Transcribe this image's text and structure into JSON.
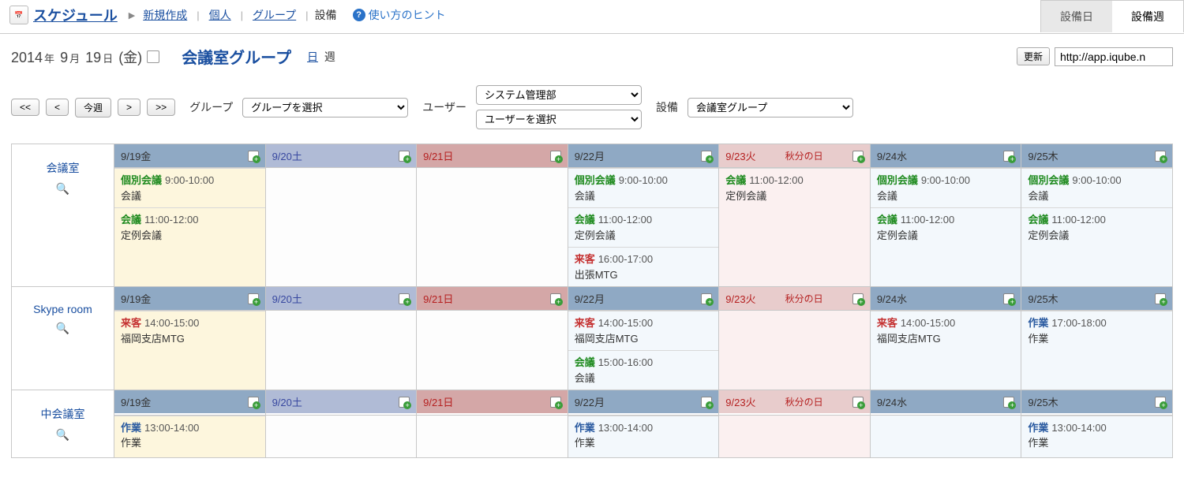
{
  "nav": {
    "main": "スケジュール",
    "links": [
      "新規作成",
      "個人",
      "グループ"
    ],
    "static": "設備",
    "hint": "使い方のヒント"
  },
  "tabs": {
    "facility_day": "設備日",
    "facility_week": "設備週"
  },
  "header": {
    "year": "2014",
    "year_u": "年",
    "month": "9",
    "month_u": "月",
    "day": "19",
    "day_u": "日",
    "dow": "(金)",
    "group_title": "会議室グループ",
    "day_link": "日",
    "week_static": "週",
    "update_btn": "更新",
    "url": "http://app.iqube.n"
  },
  "filters": {
    "nav": {
      "first": "<<",
      "prev": "<",
      "today": "今週",
      "next": ">",
      "last": ">>"
    },
    "group_label": "グループ",
    "group_select": "グループを選択",
    "user_label": "ユーザー",
    "dept_select": "システム管理部",
    "user_select": "ユーザーを選択",
    "facility_label": "設備",
    "facility_select": "会議室グループ"
  },
  "days": [
    {
      "label": "9/19金",
      "cls": "fri"
    },
    {
      "label": "9/20土",
      "cls": "sat"
    },
    {
      "label": "9/21日",
      "cls": "sun"
    },
    {
      "label": "9/22月",
      "cls": "wday"
    },
    {
      "label": "9/23火",
      "cls": "hol",
      "holiday": "秋分の日"
    },
    {
      "label": "9/24水",
      "cls": "wday"
    },
    {
      "label": "9/25木",
      "cls": "wday"
    }
  ],
  "resources": [
    {
      "name": "会議室",
      "cells": [
        [
          {
            "tag": "個別会議",
            "tagcls": "green",
            "time": "9:00-10:00",
            "title": "会議"
          },
          {
            "tag": "会議",
            "tagcls": "green",
            "time": "11:00-12:00",
            "title": "定例会議"
          }
        ],
        [],
        [],
        [
          {
            "tag": "個別会議",
            "tagcls": "green",
            "time": "9:00-10:00",
            "title": "会議"
          },
          {
            "tag": "会議",
            "tagcls": "green",
            "time": "11:00-12:00",
            "title": "定例会議"
          },
          {
            "tag": "来客",
            "tagcls": "red",
            "time": "16:00-17:00",
            "title": "出張MTG"
          }
        ],
        [
          {
            "tag": "会議",
            "tagcls": "green",
            "time": "11:00-12:00",
            "title": "定例会議"
          }
        ],
        [
          {
            "tag": "個別会議",
            "tagcls": "green",
            "time": "9:00-10:00",
            "title": "会議"
          },
          {
            "tag": "会議",
            "tagcls": "green",
            "time": "11:00-12:00",
            "title": "定例会議"
          }
        ],
        [
          {
            "tag": "個別会議",
            "tagcls": "green",
            "time": "9:00-10:00",
            "title": "会議"
          },
          {
            "tag": "会議",
            "tagcls": "green",
            "time": "11:00-12:00",
            "title": "定例会議"
          }
        ]
      ]
    },
    {
      "name": "Skype room",
      "cells": [
        [
          {
            "tag": "来客",
            "tagcls": "red",
            "time": "14:00-15:00",
            "title": "福岡支店MTG"
          }
        ],
        [],
        [],
        [
          {
            "tag": "来客",
            "tagcls": "red",
            "time": "14:00-15:00",
            "title": "福岡支店MTG"
          },
          {
            "tag": "会議",
            "tagcls": "green",
            "time": "15:00-16:00",
            "title": "会議"
          }
        ],
        [],
        [
          {
            "tag": "来客",
            "tagcls": "red",
            "time": "14:00-15:00",
            "title": "福岡支店MTG"
          }
        ],
        [
          {
            "tag": "作業",
            "tagcls": "blue",
            "time": "17:00-18:00",
            "title": "作業"
          }
        ]
      ]
    },
    {
      "name": "中会議室",
      "cells": [
        [
          {
            "tag": "作業",
            "tagcls": "blue",
            "time": "13:00-14:00",
            "title": "作業"
          }
        ],
        [],
        [],
        [
          {
            "tag": "作業",
            "tagcls": "blue",
            "time": "13:00-14:00",
            "title": "作業"
          }
        ],
        [],
        [],
        [
          {
            "tag": "作業",
            "tagcls": "blue",
            "time": "13:00-14:00",
            "title": "作業"
          }
        ]
      ]
    }
  ]
}
